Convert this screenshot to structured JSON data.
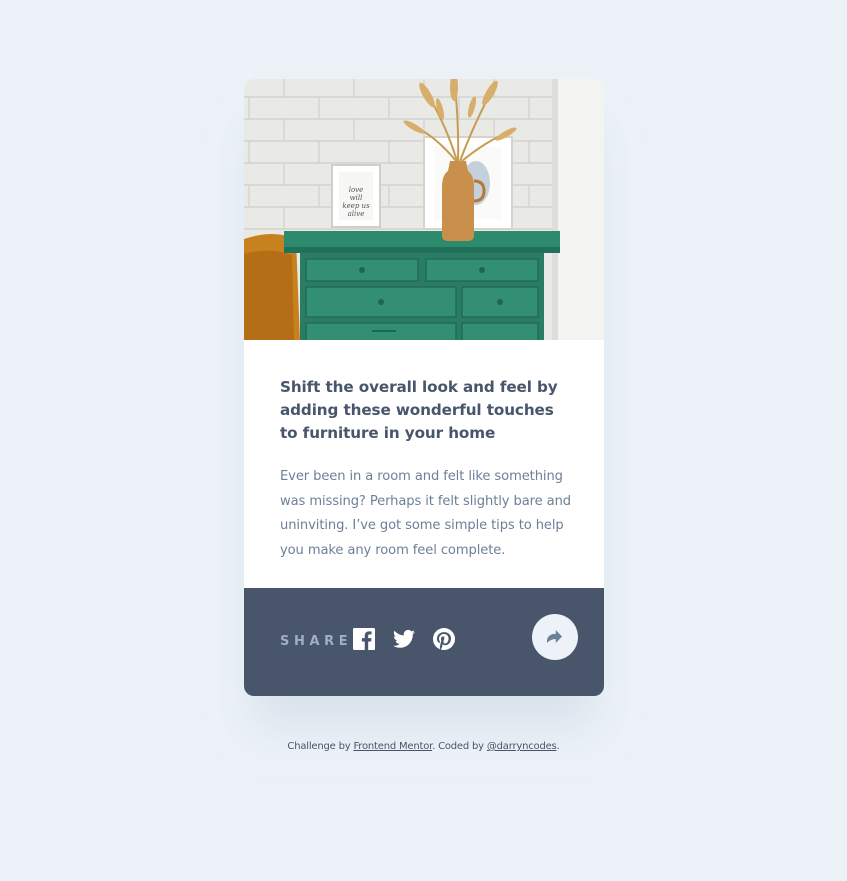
{
  "article": {
    "title": "Shift the overall look and feel by adding these wonderful touches to furniture in your home",
    "description": "Ever been in a room and felt like something was missing? Perhaps it felt slightly bare and uninviting. I’ve got some simple tips to help you make any room feel complete.",
    "image_icon": "drawers-photo",
    "frame_text": "love will keep us alive"
  },
  "share": {
    "label": "SHARE",
    "icons": [
      "facebook-icon",
      "twitter-icon",
      "pinterest-icon"
    ],
    "button_icon": "share-arrow-icon"
  },
  "attribution": {
    "prefix": "Challenge by ",
    "link1": "Frontend Mentor",
    "middle": ". Coded by ",
    "link2": "@darryncodes",
    "suffix": "."
  },
  "colors": {
    "background": "#ecf2f8",
    "share_bar": "#48556a",
    "heading": "#48556a",
    "body_text": "#6e8098",
    "icon": "#ffffff",
    "share_button": "#ecf2f8"
  }
}
